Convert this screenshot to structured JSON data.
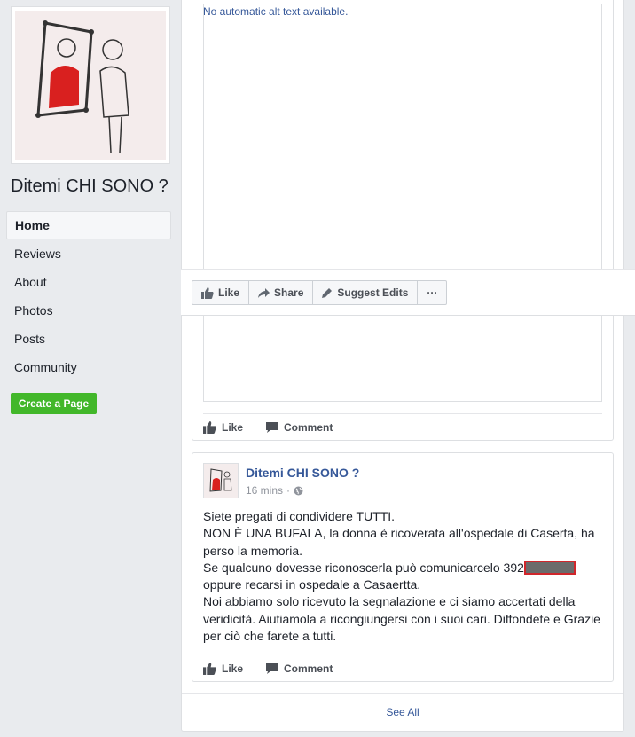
{
  "sidebar": {
    "page_name": "Ditemi CHI SONO ?",
    "nav": [
      {
        "label": "Home",
        "active": true
      },
      {
        "label": "Reviews"
      },
      {
        "label": "About"
      },
      {
        "label": "Photos"
      },
      {
        "label": "Posts"
      },
      {
        "label": "Community"
      }
    ],
    "create_page": "Create a Page"
  },
  "photo_post": {
    "alt_text": "No automatic alt text available.",
    "photo_actions": {
      "like": "Like",
      "share": "Share",
      "suggest_edits": "Suggest Edits",
      "more": "···"
    },
    "actions": {
      "like": "Like",
      "comment": "Comment"
    }
  },
  "text_post": {
    "author": "Ditemi CHI SONO ?",
    "time": "16 mins",
    "privacy_icon": "globe-icon",
    "lines": [
      "Siete pregati di condividere TUTTI.",
      "NON È UNA BUFALA, la donna è ricoverata all'ospedale di Caserta, ha perso la memoria.",
      "Se qualcuno dovesse riconoscerla può comunicarcelo 392",
      "oppure recarsi in ospedale a Casaertta.",
      "Noi abbiamo solo ricevuto la segnalazione e ci siamo accertati della veridicità. Aiutiamola a ricongiungersi con i suoi cari. Diffondete e Grazie per ciò che farete a tutti."
    ],
    "actions": {
      "like": "Like",
      "comment": "Comment"
    }
  },
  "see_all": "See All",
  "colors": {
    "link": "#365899",
    "green": "#42b72a",
    "bg": "#e9ebee",
    "redact_border": "#d0262b"
  }
}
